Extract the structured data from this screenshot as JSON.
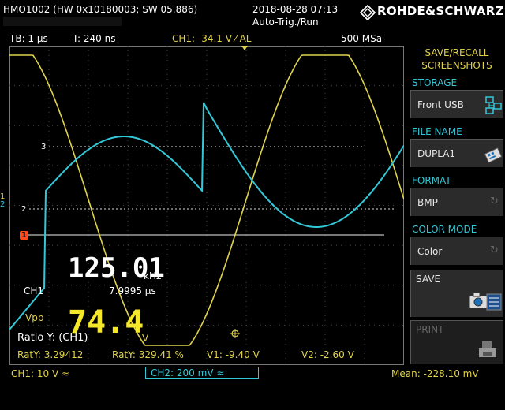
{
  "header": {
    "device": "HMO1002 (HW 0x10180003; SW 05.886)",
    "datetime": "2018-08-28 07:13",
    "trigger_mode": "Auto-Trig./Run",
    "brand": "ROHDE&SCHWARZ"
  },
  "infobar": {
    "timebase": "TB: 1 µs",
    "trigger_time": "T: 240 ns",
    "trigger_info": "CH1: -34.1 V ⁄ AL",
    "sample_rate": "500 MSa"
  },
  "sidebar": {
    "title_line1": "SAVE/RECALL",
    "title_line2": "SCREENSHOTS",
    "storage_label": "STORAGE",
    "storage_value": "Front USB",
    "filename_label": "FILE NAME",
    "filename_value": "DUPLA1",
    "format_label": "FORMAT",
    "format_value": "BMP",
    "colormode_label": "COLOR MODE",
    "colormode_value": "Color",
    "save_label": "SAVE",
    "print_label": "PRINT"
  },
  "measurements": {
    "frequency_value": "125.01",
    "frequency_unit": "kHz",
    "channel_label": "CH1",
    "period": "7.9995 µs",
    "vpp_label": "Vpp",
    "vpp_value": "74.4",
    "vpp_unit": "V",
    "ratio_label": "Ratio Y: (CH1)",
    "raty1": "RatY: 3.29412",
    "raty2": "RatY: 329.41 %",
    "v1": "V1: -9.40 V",
    "v2": "V2: -2.60 V"
  },
  "markers": {
    "ref3": "3",
    "ref2": "2",
    "ref1": "1",
    "left2": "2"
  },
  "footer": {
    "ch1": "CH1: 10 V ≈",
    "ch2": "CH2: 200 mV ≈",
    "mean": "Mean: -228.10 mV"
  },
  "colors": {
    "ch1": "#e0d24a",
    "ch2": "#33c8d8",
    "accent": "#33c8d8",
    "trigger_marker": "#ff4a1a"
  }
}
